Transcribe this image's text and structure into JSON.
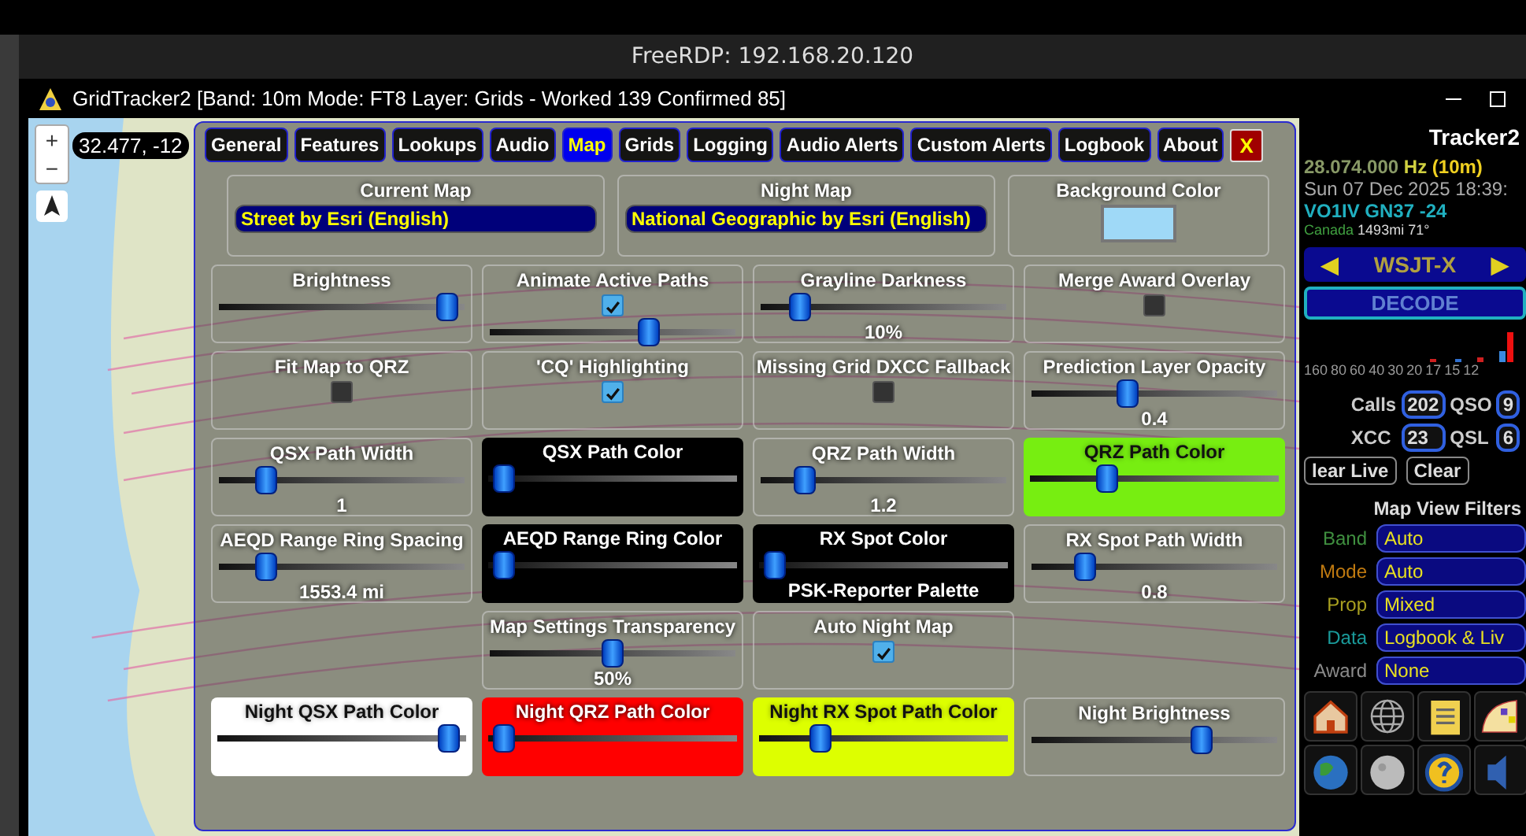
{
  "desktop_window": {
    "title": "FreeRDP: 192.168.20.120"
  },
  "app_window": {
    "title": "GridTracker2 [Band: 10m Mode: FT8 Layer: Grids - Worked 139 Confirmed 85]"
  },
  "map": {
    "zoom_in": "+",
    "zoom_out": "−",
    "coordinates": "32.477, -12"
  },
  "settings": {
    "close": "X",
    "tabs": [
      {
        "label": "General",
        "selected": false
      },
      {
        "label": "Features",
        "selected": false
      },
      {
        "label": "Lookups",
        "selected": false
      },
      {
        "label": "Audio",
        "selected": false
      },
      {
        "label": "Map",
        "selected": true
      },
      {
        "label": "Grids",
        "selected": false
      },
      {
        "label": "Logging",
        "selected": false
      },
      {
        "label": "Audio Alerts",
        "selected": false
      },
      {
        "label": "Custom Alerts",
        "selected": false
      },
      {
        "label": "Logbook",
        "selected": false
      },
      {
        "label": "About",
        "selected": false
      }
    ],
    "top_row": [
      {
        "kind": "select",
        "label": "Current Map",
        "value": "Street by Esri (English)"
      },
      {
        "kind": "select",
        "label": "Night Map",
        "value": "National Geographic by Esri (English)"
      },
      {
        "kind": "swatch",
        "label": "Background Color",
        "color": "#9fd9f7"
      }
    ],
    "cells": [
      {
        "kind": "slider",
        "label": "Brightness",
        "level": 0.97
      },
      {
        "kind": "check_slider",
        "label": "Animate Active Paths",
        "checked": true,
        "level": 0.66
      },
      {
        "kind": "slider",
        "label": "Grayline Darkness",
        "level": 0.13,
        "value": "10%"
      },
      {
        "kind": "checkbox",
        "label": "Merge Award Overlay",
        "checked": false
      },
      {
        "kind": "checkbox",
        "label": "Fit Map to QRZ",
        "checked": false
      },
      {
        "kind": "checkbox",
        "label": "'CQ' Highlighting",
        "checked": true
      },
      {
        "kind": "checkbox",
        "label": "Missing Grid DXCC Fallback",
        "checked": false
      },
      {
        "kind": "slider",
        "label": "Prediction Layer Opacity",
        "level": 0.38,
        "value": "0.4"
      },
      {
        "kind": "slider",
        "label": "QSX Path Width",
        "level": 0.16,
        "value": "1"
      },
      {
        "kind": "color",
        "label": "QSX Path Color",
        "level": 0.02,
        "color": "#000000"
      },
      {
        "kind": "slider",
        "label": "QRZ Path Width",
        "level": 0.15,
        "value": "1.2"
      },
      {
        "kind": "color",
        "label": "QRZ Path Color",
        "level": 0.29,
        "color": "#77ee11"
      },
      {
        "kind": "slider",
        "label": "AEQD Range Ring Spacing",
        "level": 0.16,
        "value": "1553.4 mi"
      },
      {
        "kind": "color",
        "label": "AEQD Range Ring Color",
        "level": 0.02,
        "color": "#000000"
      },
      {
        "kind": "color",
        "label": "RX Spot Color",
        "level": 0.02,
        "color": "#000000",
        "value": "PSK-Reporter Palette"
      },
      {
        "kind": "slider",
        "label": "RX Spot Path Width",
        "level": 0.19,
        "value": "0.8"
      },
      {
        "kind": "empty"
      },
      {
        "kind": "slider",
        "label": "Map Settings Transparency",
        "level": 0.5,
        "value": "50%"
      },
      {
        "kind": "checkbox",
        "label": "Auto Night Map",
        "checked": true
      },
      {
        "kind": "empty"
      },
      {
        "kind": "color",
        "label": "Night QSX Path Color",
        "level": 0.97,
        "color": "#ffffff"
      },
      {
        "kind": "color",
        "label": "Night QRZ Path Color",
        "level": 0.02,
        "color": "#ff0000"
      },
      {
        "kind": "color",
        "label": "Night RX Spot Path Color",
        "level": 0.22,
        "color": "#ddff00"
      },
      {
        "kind": "slider",
        "label": "Night Brightness",
        "level": 0.71
      }
    ]
  },
  "sidebar": {
    "app_name": "Tracker2",
    "frequency": "28.074.000",
    "unit": "Hz",
    "band": "(10m)",
    "datetime": "Sun 07 Dec 2025 18:39:",
    "station": "VO1IV GN37 -24",
    "country": "Canada",
    "distance": "1493mi 71°",
    "prev": "◀",
    "source": "WSJT-X",
    "next": "▶",
    "decode": "DECODE",
    "band_labels": [
      "160",
      "80",
      "60",
      "40",
      "30",
      "20",
      "17",
      "15",
      "12"
    ],
    "stats": [
      {
        "label": "Calls",
        "value": "202"
      },
      {
        "label": "QSO",
        "value": "9"
      },
      {
        "label": "XCC",
        "value": "23"
      },
      {
        "label": "QSL",
        "value": "6"
      }
    ],
    "buttons": [
      "lear Live",
      "Clear"
    ],
    "filters_title": "Map View Filters",
    "filters": [
      {
        "label": "Band",
        "value": "Auto",
        "color": "#3f8f3f"
      },
      {
        "label": "Mode",
        "value": "Auto",
        "color": "#c07a10"
      },
      {
        "label": "Prop",
        "value": "Mixed",
        "color": "#a8a020"
      },
      {
        "label": "Data",
        "value": "Logbook & Liv",
        "color": "#1a9a9a"
      },
      {
        "label": "Award",
        "value": "None",
        "color": "#8a8a8a"
      }
    ]
  }
}
